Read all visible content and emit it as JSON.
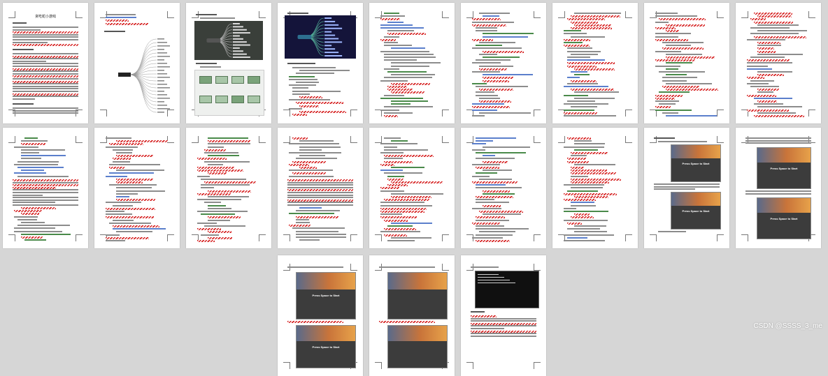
{
  "document": {
    "pages": [
      {
        "kind": "title",
        "title": "贪吃蛇小游戏"
      },
      {
        "kind": "tree"
      },
      {
        "kind": "mindmap-images"
      },
      {
        "kind": "dark-mindmap"
      },
      {
        "kind": "code"
      },
      {
        "kind": "code"
      },
      {
        "kind": "code"
      },
      {
        "kind": "code"
      },
      {
        "kind": "code"
      },
      {
        "kind": "text-code"
      },
      {
        "kind": "code"
      },
      {
        "kind": "code"
      },
      {
        "kind": "text-code"
      },
      {
        "kind": "code"
      },
      {
        "kind": "code"
      },
      {
        "kind": "code"
      },
      {
        "kind": "game",
        "screen_text": "Press Space to Start"
      },
      {
        "kind": "game2",
        "screen_text": "Press Space to Start"
      },
      {
        "kind": "game-bottom",
        "screen_text": "Press Space to Start"
      },
      {
        "kind": "game-bottom",
        "screen_text": ""
      },
      {
        "kind": "terminal"
      }
    ]
  },
  "watermark": "CSDN @SSSS_3_me",
  "colors": {
    "background": "#d6d6d6",
    "squiggle": "#d62222",
    "comment": "#4a8a4a",
    "highlight": "#5b7fcc"
  }
}
